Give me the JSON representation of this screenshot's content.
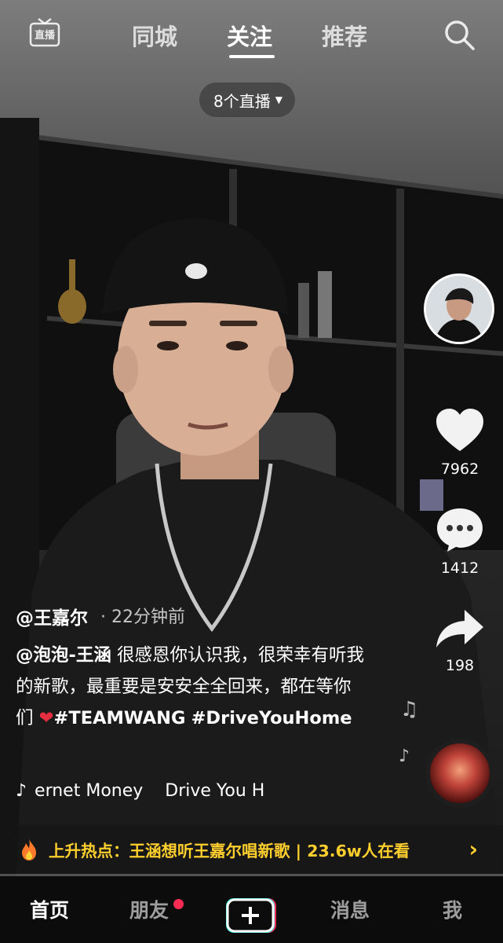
{
  "top_tabs": [
    "同城",
    "关注",
    "推荐"
  ],
  "live_icon_label": "直播",
  "live_count": "8个直播",
  "right_rail": {
    "likes": "7962",
    "comments": "1412",
    "shares": "198"
  },
  "post": {
    "author": "@王嘉尔",
    "time": "· 22分钟前",
    "caption_mention": "@泡泡-王涵",
    "caption_text_1": " 很感恩你认识我，很荣幸有听我的新歌，最重要是安安全全回来，都在等你们 ",
    "caption_heart": "❤",
    "caption_tag_1": "#TEAMWANG",
    "caption_tag_2": "#DriveYouHome",
    "music": "ernet Money    Drive You H"
  },
  "hot_topic": {
    "label": "上升热点：",
    "text": "王涵想听王嘉尔唱新歌 | 23.6w人在看"
  },
  "bottom_nav": {
    "home": "首页",
    "friends": "朋友",
    "messages": "消息",
    "me": "我"
  },
  "colors": {
    "accent_red": "#fe2c55",
    "hot_yellow": "#ffcf2e",
    "heart_red": "#e52e3f"
  },
  "playback_progress": 0.0
}
